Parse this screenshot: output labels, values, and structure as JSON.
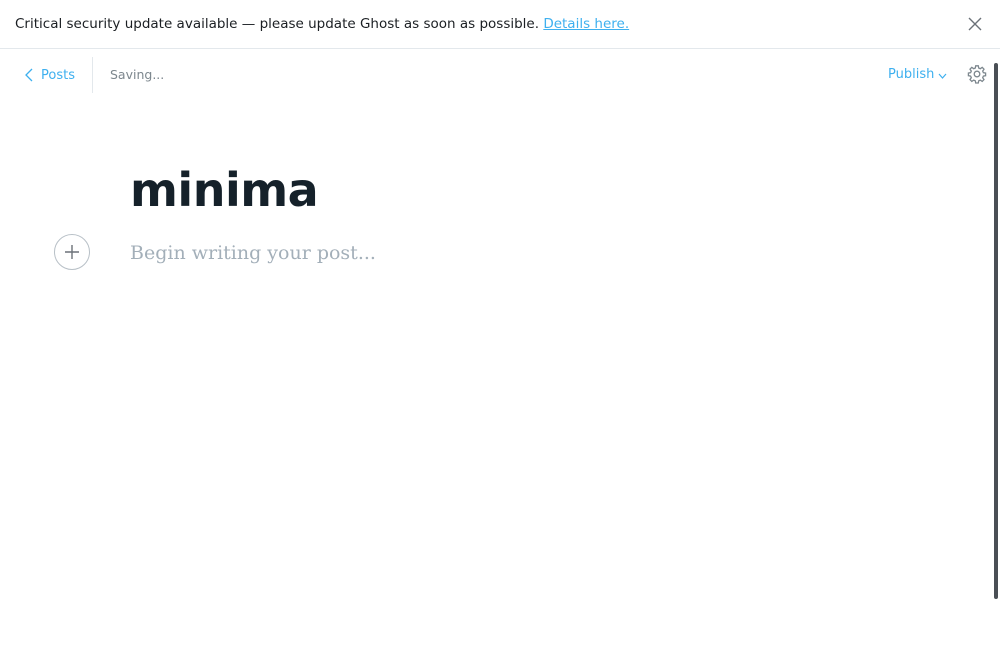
{
  "banner": {
    "message": "Critical security update available — please update Ghost as soon as possible.",
    "link_text": "Details here.",
    "close_icon": "close-icon"
  },
  "toolbar": {
    "back_label": "Posts",
    "back_icon": "chevron-left-icon",
    "status": "Saving...",
    "publish_label": "Publish",
    "publish_icon": "chevron-down-icon",
    "settings_icon": "gear-icon"
  },
  "editor": {
    "title": "minima",
    "body_placeholder": "Begin writing your post...",
    "add_card_icon": "plus-icon"
  },
  "colors": {
    "accent": "#3eb0ef",
    "text": "#15212a",
    "muted": "#7d878e",
    "placeholder": "#a3afb9"
  }
}
